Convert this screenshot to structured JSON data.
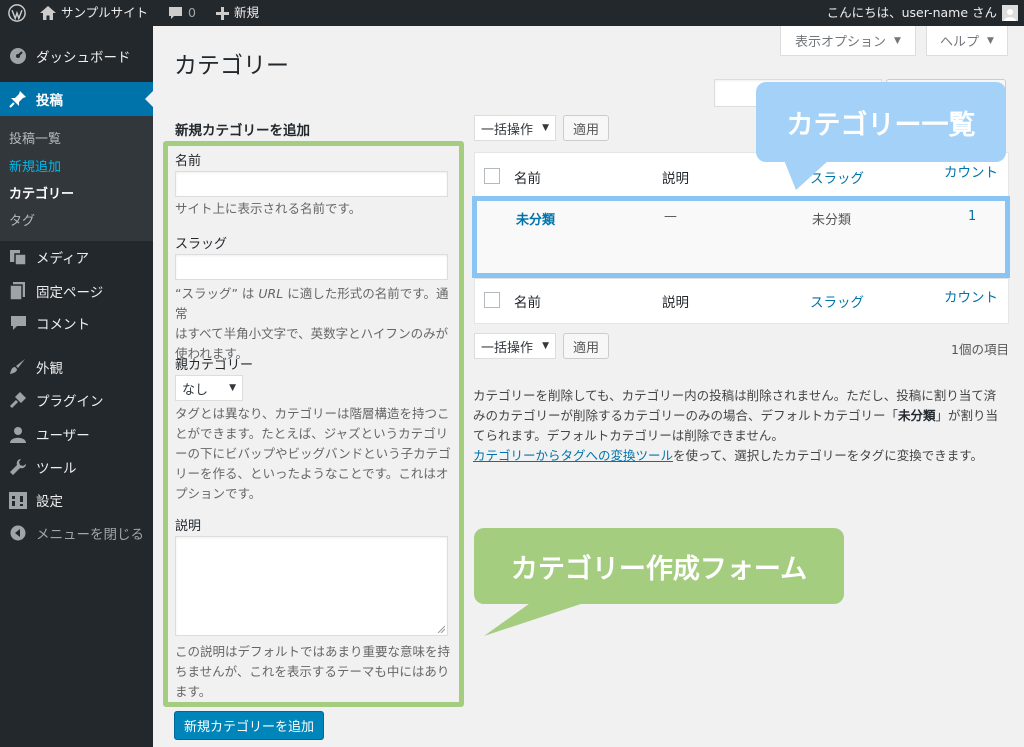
{
  "adminbar": {
    "site_name": "サンプルサイト",
    "comment_count": "0",
    "new_label": "新規",
    "greeting": "こんにちは、user-name さん"
  },
  "sidebar": {
    "items": [
      {
        "label": "ダッシュボード",
        "icon": "dashboard-icon"
      },
      {
        "label": "投稿",
        "icon": "pin-icon"
      },
      {
        "label": "メディア",
        "icon": "media-icon"
      },
      {
        "label": "固定ページ",
        "icon": "page-icon"
      },
      {
        "label": "コメント",
        "icon": "comment-icon"
      },
      {
        "label": "外観",
        "icon": "brush-icon"
      },
      {
        "label": "プラグイン",
        "icon": "plugin-icon"
      },
      {
        "label": "ユーザー",
        "icon": "user-icon"
      },
      {
        "label": "ツール",
        "icon": "wrench-icon"
      },
      {
        "label": "設定",
        "icon": "settings-icon"
      },
      {
        "label": "メニューを閉じる",
        "icon": "collapse-icon"
      }
    ],
    "submenu": [
      "投稿一覧",
      "新規追加",
      "カテゴリー",
      "タグ"
    ]
  },
  "header": {
    "screen_options": "表示オプション",
    "help": "ヘルプ",
    "title": "カテゴリー"
  },
  "form": {
    "heading": "新規カテゴリーを追加",
    "name_label": "名前",
    "name_desc": "サイト上に表示される名前です。",
    "slug_label": "スラッグ",
    "slug_desc_1a": "“スラッグ” は ",
    "slug_desc_1b": "URL",
    "slug_desc_1c": " に適した形式の名前です。通常",
    "slug_desc_2": "はすべて半角小文字で、英数字とハイフンのみが",
    "slug_desc_3": "使われます。",
    "parent_label": "親カテゴリー",
    "parent_value": "なし",
    "parent_desc": [
      "タグとは異なり、カテゴリーは階層構造を持つこ",
      "とができます。たとえば、ジャズというカテゴリ",
      "ーの下にビバップやビッグバンドという子カテゴ",
      "リーを作る、といったようなことです。これはオ",
      "プションです。"
    ],
    "description_label": "説明",
    "description_desc": [
      "この説明はデフォルトではあまり重要な意味を持",
      "ちませんが、これを表示するテーマも中にはあり",
      "ます。"
    ],
    "submit": "新規カテゴリーを追加"
  },
  "list": {
    "bulk_action": "一括操作",
    "apply": "適用",
    "item_count": "1個の項目",
    "columns": {
      "name": "名前",
      "description": "説明",
      "slug": "スラッグ",
      "count": "カウント"
    },
    "rows": [
      {
        "name": "未分類",
        "description": "—",
        "slug": "未分類",
        "count": "1"
      }
    ]
  },
  "notes": {
    "line1": "カテゴリーを削除しても、カテゴリー内の投稿は削除されません。ただし、投稿に割り当て済",
    "line2a": "みのカテゴリーが削除するカテゴリーのみの場合、デフォルトカテゴリー「",
    "line2b": "未分類",
    "line2c": "」が割り当",
    "line3": "てられます。デフォルトカテゴリーは削除できません。",
    "link": "カテゴリーからタグへの変換ツール",
    "line4": "を使って、選択したカテゴリーをタグに変換できます。"
  },
  "callouts": {
    "list": "カテゴリー一覧",
    "form": "カテゴリー作成フォーム"
  },
  "colors": {
    "admin_dark": "#23282d",
    "wp_blue": "#0073aa",
    "green_callout": "#a5cd7f",
    "blue_callout": "#a3d1f7"
  }
}
